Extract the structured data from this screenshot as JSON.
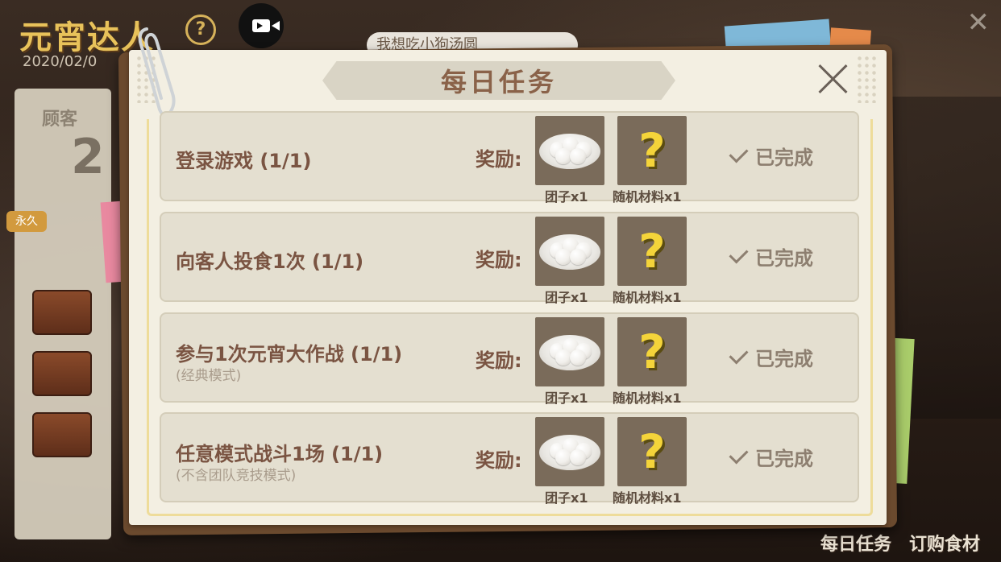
{
  "background": {
    "logo": "元宵达人",
    "help_symbol": "?",
    "date": "2020/02/0",
    "close_symbol": "✕",
    "speech_bubble": "我想吃小狗汤圆",
    "side_panel_label": "顾客",
    "side_panel_number": "2",
    "side_tag": "永久",
    "bottom_buttons": [
      "每日任务",
      "订购食材"
    ]
  },
  "dialog": {
    "title": "每日任务",
    "close_label": "close"
  },
  "reward_label": "奖励:",
  "tasks": [
    {
      "name": "登录游戏 (1/1)",
      "sub": "",
      "rewards": [
        {
          "icon": "tangyuan-plate-icon",
          "caption": "团子x1"
        },
        {
          "icon": "question-mark-icon",
          "caption": "随机材料x1",
          "symbol": "?"
        }
      ],
      "status": "已完成"
    },
    {
      "name": "向客人投食1次 (1/1)",
      "sub": "",
      "rewards": [
        {
          "icon": "tangyuan-plate-icon",
          "caption": "团子x1"
        },
        {
          "icon": "question-mark-icon",
          "caption": "随机材料x1",
          "symbol": "?"
        }
      ],
      "status": "已完成"
    },
    {
      "name": "参与1次元宵大作战 (1/1)",
      "sub": "(经典模式)",
      "rewards": [
        {
          "icon": "tangyuan-plate-icon",
          "caption": "团子x1"
        },
        {
          "icon": "question-mark-icon",
          "caption": "随机材料x1",
          "symbol": "?"
        }
      ],
      "status": "已完成"
    },
    {
      "name": "任意模式战斗1场 (1/1)",
      "sub": "(不含团队竞技模式)",
      "rewards": [
        {
          "icon": "tangyuan-plate-icon",
          "caption": "团子x1"
        },
        {
          "icon": "question-mark-icon",
          "caption": "随机材料x1",
          "symbol": "?"
        }
      ],
      "status": "已完成"
    }
  ]
}
